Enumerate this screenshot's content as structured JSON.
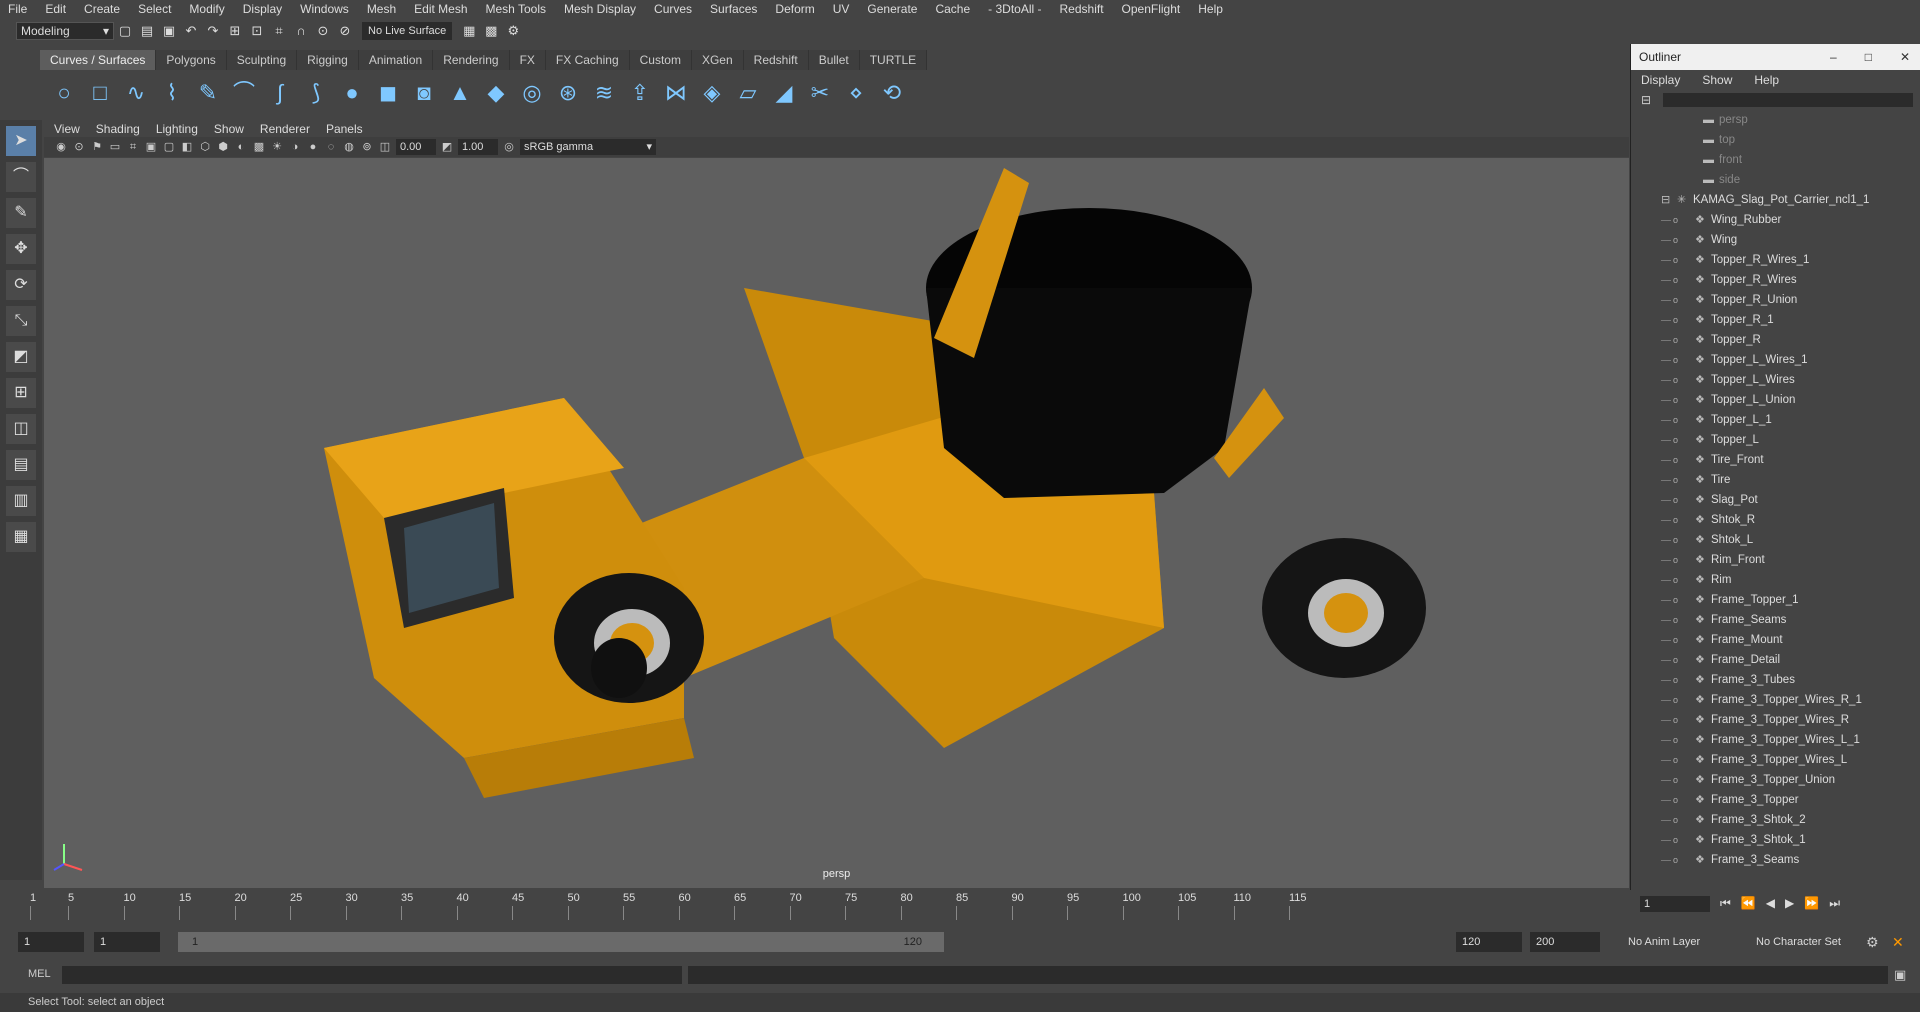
{
  "menubar": [
    "File",
    "Edit",
    "Create",
    "Select",
    "Modify",
    "Display",
    "Windows",
    "Mesh",
    "Edit Mesh",
    "Mesh Tools",
    "Mesh Display",
    "Curves",
    "Surfaces",
    "Deform",
    "UV",
    "Generate",
    "Cache",
    "- 3DtoAll -",
    "Redshift",
    "OpenFlight",
    "Help"
  ],
  "mode": "Modeling",
  "live_surface": "No Live Surface",
  "shelf_tabs": [
    "Curves / Surfaces",
    "Polygons",
    "Sculpting",
    "Rigging",
    "Animation",
    "Rendering",
    "FX",
    "FX Caching",
    "Custom",
    "XGen",
    "Redshift",
    "Bullet",
    "TURTLE"
  ],
  "panel_menu": [
    "View",
    "Shading",
    "Lighting",
    "Show",
    "Renderer",
    "Panels"
  ],
  "panel": {
    "exposure": "0.00",
    "gamma_val": "1.00",
    "colorspace": "sRGB gamma"
  },
  "viewport_label": "persp",
  "outliner": {
    "title": "Outliner",
    "menu": [
      "Display",
      "Show",
      "Help"
    ],
    "cameras": [
      "persp",
      "top",
      "front",
      "side"
    ],
    "group": "KAMAG_Slag_Pot_Carrier_ncl1_1",
    "children": [
      "Wing_Rubber",
      "Wing",
      "Topper_R_Wires_1",
      "Topper_R_Wires",
      "Topper_R_Union",
      "Topper_R_1",
      "Topper_R",
      "Topper_L_Wires_1",
      "Topper_L_Wires",
      "Topper_L_Union",
      "Topper_L_1",
      "Topper_L",
      "Tire_Front",
      "Tire",
      "Slag_Pot",
      "Shtok_R",
      "Shtok_L",
      "Rim_Front",
      "Rim",
      "Frame_Topper_1",
      "Frame_Seams",
      "Frame_Mount",
      "Frame_Detail",
      "Frame_3_Tubes",
      "Frame_3_Topper_Wires_R_1",
      "Frame_3_Topper_Wires_R",
      "Frame_3_Topper_Wires_L_1",
      "Frame_3_Topper_Wires_L",
      "Frame_3_Topper_Union",
      "Frame_3_Topper",
      "Frame_3_Shtok_2",
      "Frame_3_Shtok_1",
      "Frame_3_Seams"
    ]
  },
  "timeline": {
    "ticks": [
      "1",
      "5",
      "10",
      "15",
      "20",
      "25",
      "30",
      "35",
      "40",
      "45",
      "50",
      "55",
      "60",
      "65",
      "70",
      "75",
      "80",
      "85",
      "90",
      "95",
      "100",
      "105",
      "110",
      "115"
    ],
    "current_frame": "1"
  },
  "range": {
    "start": "1",
    "start2": "1",
    "slider_start": "1",
    "slider_end": "120",
    "end": "120",
    "end2": "200",
    "anim_layer": "No Anim Layer",
    "char_set": "No Character Set"
  },
  "cmd": {
    "lang": "MEL"
  },
  "status": "Select Tool: select an object"
}
